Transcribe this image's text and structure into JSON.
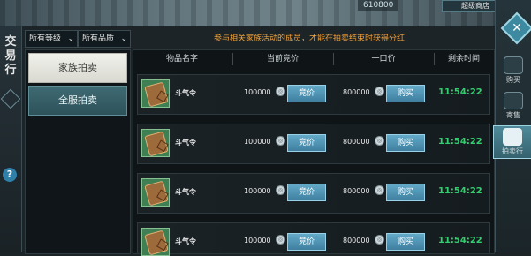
{
  "window": {
    "title_vertical": [
      "交",
      "易",
      "行"
    ]
  },
  "topbar": {
    "currency_value": "610800",
    "shop_button_label": "超级商店"
  },
  "filters": [
    {
      "label": "所有等级"
    },
    {
      "label": "所有品质"
    }
  ],
  "notice": "参与相关家族活动的成员，才能在拍卖结束时获得分红",
  "side_tabs": [
    {
      "label": "家族拍卖",
      "selected": true
    },
    {
      "label": "全服拍卖",
      "selected": false
    }
  ],
  "table": {
    "headers": [
      "物品名字",
      "当前竞价",
      "一口价",
      "剩余时间"
    ],
    "rows": [
      {
        "item": "斗气令",
        "bid": "100000",
        "bid_button": "竞价",
        "buyout": "800000",
        "buy_button": "购买",
        "time": "11:54:22"
      },
      {
        "item": "斗气令",
        "bid": "100000",
        "bid_button": "竞价",
        "buyout": "800000",
        "buy_button": "购买",
        "time": "11:54:22"
      },
      {
        "item": "斗气令",
        "bid": "100000",
        "bid_button": "竞价",
        "buyout": "800000",
        "buy_button": "购买",
        "time": "11:54:22"
      },
      {
        "item": "斗气令",
        "bid": "100000",
        "bid_button": "竞价",
        "buyout": "800000",
        "buy_button": "购买",
        "time": "11:54:22"
      }
    ]
  },
  "right_tabs": [
    {
      "label": "购买",
      "active": false
    },
    {
      "label": "寄售",
      "active": false
    },
    {
      "label": "拍卖行",
      "active": true
    }
  ],
  "help_label": "?",
  "close_label": "✕",
  "colors": {
    "time_green": "#30d16c",
    "notice_orange": "#f0a23b",
    "button_blue": "#4f93b6"
  }
}
